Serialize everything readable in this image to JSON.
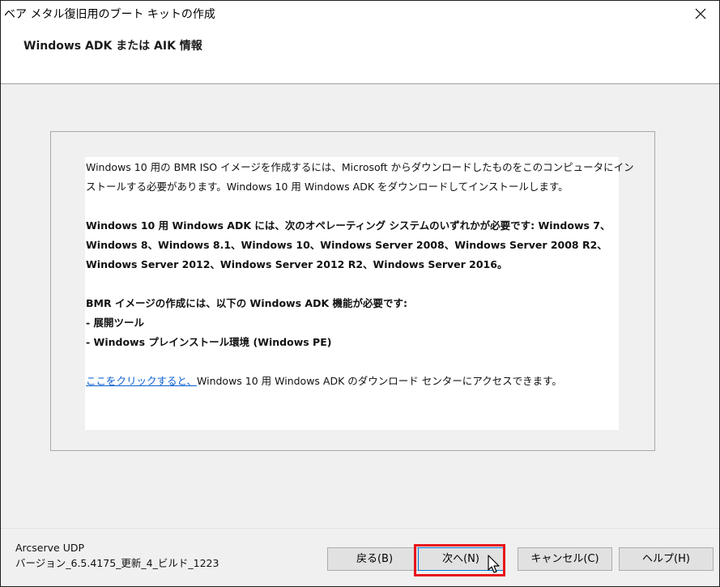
{
  "window": {
    "title": "ベア メタル復旧用のブート キットの作成",
    "close_glyph": "✕"
  },
  "header": {
    "title": "Windows ADK または AIK 情報"
  },
  "content": {
    "para1_line1": "Windows 10 用の BMR ISO イメージを作成するには、Microsoft からダウンロードしたものをこのコンピュータにイン",
    "para1_line2": "ストールする必要があります。Windows 10 用 Windows ADK をダウンロードしてインストールします。",
    "para2_line1": "Windows 10 用 Windows ADK には、次のオペレーティング システムのいずれかが必要です: Windows 7、",
    "para2_line2": "Windows 8、Windows 8.1、Windows 10、Windows Server 2008、Windows Server 2008 R2、",
    "para2_line3": "Windows Server 2012、Windows Server 2012 R2、Windows Server 2016。",
    "para3_line1": "BMR イメージの作成には、以下の Windows ADK 機能が必要です:",
    "para3_item1": "- 展開ツール",
    "para3_item2": "- Windows プレインストール環境 (Windows PE)",
    "link_text": "ここをクリックすると、",
    "link_suffix": "Windows 10 用 Windows ADK のダウンロード センターにアクセスできます。"
  },
  "footer": {
    "app_name": "Arcserve UDP",
    "version": "バージョン_6.5.4175_更新_4_ビルド_1223",
    "buttons": {
      "back": "戻る(B)",
      "next": "次へ(N)",
      "cancel": "キャンセル(C)",
      "help": "ヘルプ(H)"
    }
  },
  "colors": {
    "link": "#0b5fd3",
    "highlight": "#e8141a",
    "focus_border": "#0078d7"
  }
}
